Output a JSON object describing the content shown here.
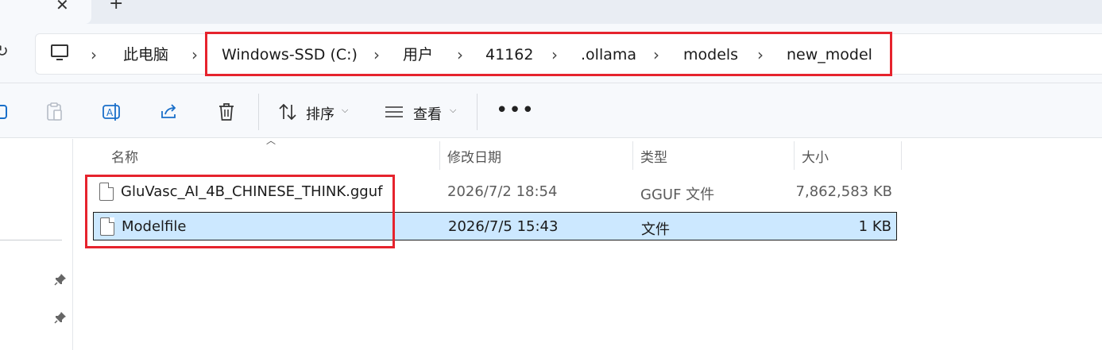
{
  "tabs": {
    "close_glyph": "✕",
    "new_tab_glyph": "+"
  },
  "toolbar_nav": {
    "refresh_icon": "refresh-icon"
  },
  "breadcrumb": {
    "items": [
      "此电脑",
      "Windows-SSD (C:)",
      "用户",
      "41162",
      ".ollama",
      "models",
      "new_model"
    ],
    "separator": "›"
  },
  "commands": {
    "sort_label": "排序",
    "view_label": "查看",
    "more_label": "•••",
    "icons": [
      "paste-icon",
      "rename-icon",
      "share-icon",
      "delete-icon",
      "sort-icon",
      "view-icon"
    ]
  },
  "columns": {
    "name": "名称",
    "date": "修改日期",
    "type": "类型",
    "size": "大小"
  },
  "files": [
    {
      "name": "GluVasc_AI_4B_CHINESE_THINK.gguf",
      "date": "2026/7/2 18:54",
      "type": "GGUF 文件",
      "size": "7,862,583 KB",
      "selected": false
    },
    {
      "name": "Modelfile",
      "date": "2026/7/5 15:43",
      "type": "文件",
      "size": "1 KB",
      "selected": true
    }
  ],
  "colors": {
    "highlight": "#e6232d",
    "selection": "#cce8ff",
    "chrome": "#f7f9fc"
  }
}
